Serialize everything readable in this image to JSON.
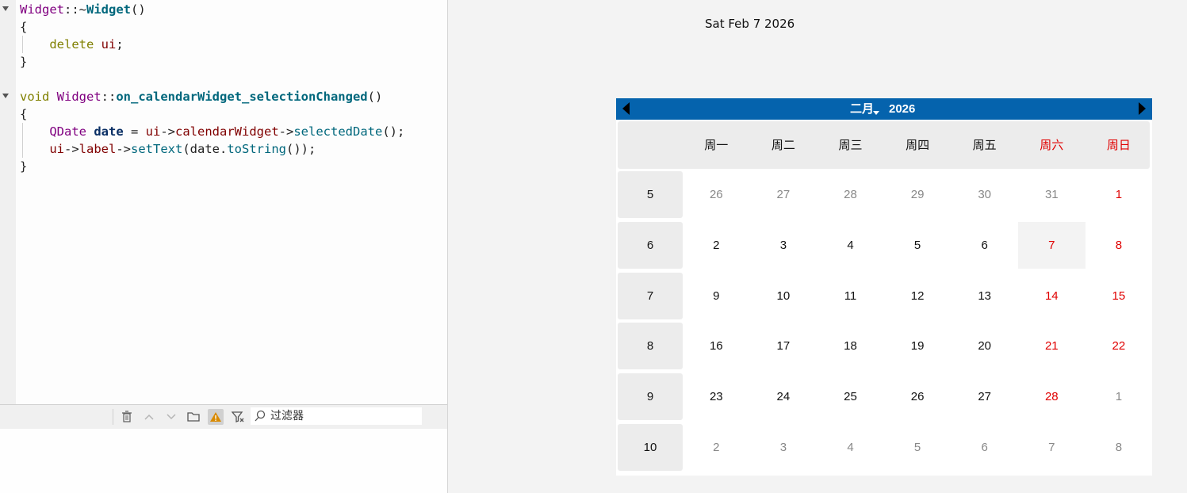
{
  "editor": {
    "lines": [
      [
        [
          "cls",
          "Widget"
        ],
        [
          "p",
          "::~"
        ],
        [
          "fnb",
          "Widget"
        ],
        [
          "p",
          "()"
        ]
      ],
      [
        [
          "p",
          "{"
        ]
      ],
      [
        [
          "p",
          "    "
        ],
        [
          "kw",
          "delete"
        ],
        [
          "p",
          " "
        ],
        [
          "mem",
          "ui"
        ],
        [
          "p",
          ";"
        ]
      ],
      [
        [
          "p",
          "}"
        ]
      ],
      [],
      [
        [
          "kw",
          "void"
        ],
        [
          "p",
          " "
        ],
        [
          "cls",
          "Widget"
        ],
        [
          "p",
          "::"
        ],
        [
          "fnb",
          "on_calendarWidget_selectionChanged"
        ],
        [
          "p",
          "()"
        ]
      ],
      [
        [
          "p",
          "{"
        ]
      ],
      [
        [
          "p",
          "    "
        ],
        [
          "cls",
          "QDate"
        ],
        [
          "p",
          " "
        ],
        [
          "var",
          "date"
        ],
        [
          "p",
          " = "
        ],
        [
          "mem",
          "ui"
        ],
        [
          "p",
          "->"
        ],
        [
          "mem",
          "calendarWidget"
        ],
        [
          "p",
          "->"
        ],
        [
          "fn",
          "selectedDate"
        ],
        [
          "p",
          "();"
        ]
      ],
      [
        [
          "p",
          "    "
        ],
        [
          "mem",
          "ui"
        ],
        [
          "p",
          "->"
        ],
        [
          "mem",
          "label"
        ],
        [
          "p",
          "->"
        ],
        [
          "fn",
          "setText"
        ],
        [
          "p",
          "(date."
        ],
        [
          "fn",
          "toString"
        ],
        [
          "p",
          "());"
        ]
      ],
      [
        [
          "p",
          "}"
        ]
      ]
    ]
  },
  "toolbar": {
    "icons": [
      "trash-icon",
      "arrow-up-icon",
      "arrow-down-icon",
      "folder-icon",
      "warning-icon",
      "filter-icon"
    ],
    "filter_placeholder": "过滤器"
  },
  "label": {
    "text": "Sat Feb 7 2026"
  },
  "calendar": {
    "month": "二月",
    "year": "2026",
    "header_color": "#0563ad",
    "weekend_color": "#e00000",
    "weekdays": [
      "周一",
      "周二",
      "周三",
      "周四",
      "周五",
      "周六",
      "周日"
    ],
    "weeks": [
      {
        "num": "5",
        "days": [
          {
            "d": "26",
            "m": "other"
          },
          {
            "d": "27",
            "m": "other"
          },
          {
            "d": "28",
            "m": "other"
          },
          {
            "d": "29",
            "m": "other"
          },
          {
            "d": "30",
            "m": "other"
          },
          {
            "d": "31",
            "m": "other"
          },
          {
            "d": "1",
            "m": "cur"
          }
        ]
      },
      {
        "num": "6",
        "days": [
          {
            "d": "2",
            "m": "cur"
          },
          {
            "d": "3",
            "m": "cur"
          },
          {
            "d": "4",
            "m": "cur"
          },
          {
            "d": "5",
            "m": "cur"
          },
          {
            "d": "6",
            "m": "cur"
          },
          {
            "d": "7",
            "m": "cur",
            "selected": true
          },
          {
            "d": "8",
            "m": "cur"
          }
        ]
      },
      {
        "num": "7",
        "days": [
          {
            "d": "9",
            "m": "cur"
          },
          {
            "d": "10",
            "m": "cur"
          },
          {
            "d": "11",
            "m": "cur"
          },
          {
            "d": "12",
            "m": "cur"
          },
          {
            "d": "13",
            "m": "cur"
          },
          {
            "d": "14",
            "m": "cur"
          },
          {
            "d": "15",
            "m": "cur"
          }
        ]
      },
      {
        "num": "8",
        "days": [
          {
            "d": "16",
            "m": "cur"
          },
          {
            "d": "17",
            "m": "cur"
          },
          {
            "d": "18",
            "m": "cur"
          },
          {
            "d": "19",
            "m": "cur"
          },
          {
            "d": "20",
            "m": "cur"
          },
          {
            "d": "21",
            "m": "cur"
          },
          {
            "d": "22",
            "m": "cur"
          }
        ]
      },
      {
        "num": "9",
        "days": [
          {
            "d": "23",
            "m": "cur"
          },
          {
            "d": "24",
            "m": "cur"
          },
          {
            "d": "25",
            "m": "cur"
          },
          {
            "d": "26",
            "m": "cur"
          },
          {
            "d": "27",
            "m": "cur"
          },
          {
            "d": "28",
            "m": "cur"
          },
          {
            "d": "1",
            "m": "other"
          }
        ]
      },
      {
        "num": "10",
        "days": [
          {
            "d": "2",
            "m": "other"
          },
          {
            "d": "3",
            "m": "other"
          },
          {
            "d": "4",
            "m": "other"
          },
          {
            "d": "5",
            "m": "other"
          },
          {
            "d": "6",
            "m": "other"
          },
          {
            "d": "7",
            "m": "other"
          },
          {
            "d": "8",
            "m": "other"
          }
        ]
      }
    ]
  }
}
